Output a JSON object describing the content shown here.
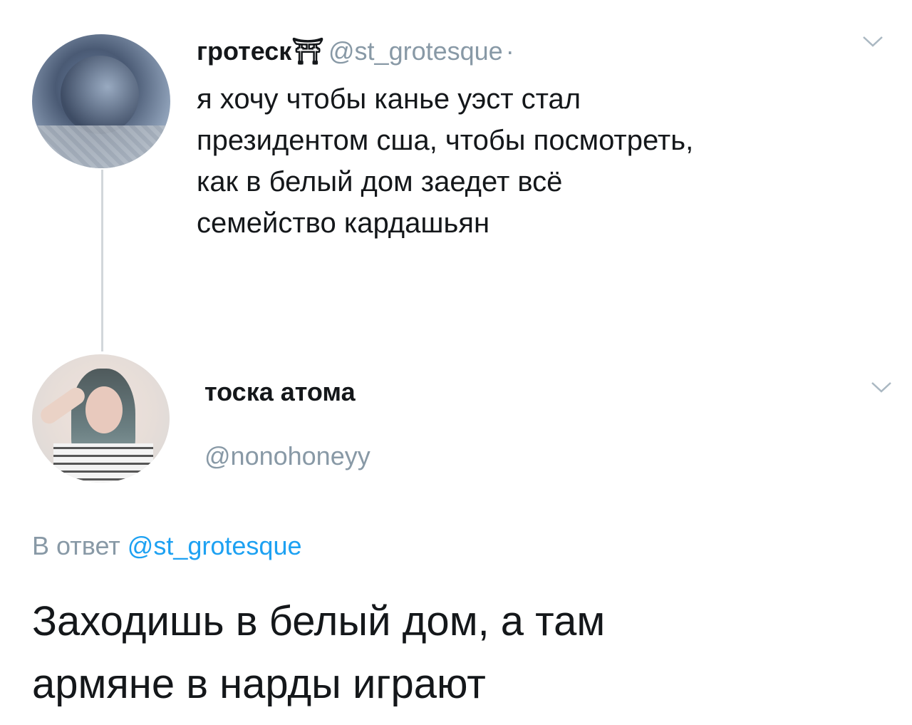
{
  "tweet": {
    "display_name": "гротеск⛩",
    "handle": "@st_grotesque",
    "separator": "·",
    "text_lines": [
      "я хочу чтобы канье уэст стал",
      "президентом сша, чтобы посмотреть,",
      "как в белый дом заедет всё",
      "семейство кардашьян"
    ],
    "avatar_icon": "user-avatar",
    "menu_icon": "chevron-down-icon"
  },
  "reply": {
    "display_name": "тоска атома",
    "handle": "@nonohoneyy",
    "reply_prefix": "В ответ",
    "reply_mention": "@st_grotesque",
    "text_lines": [
      "Заходишь в белый дом, а там",
      "армяне в нарды играют"
    ],
    "avatar_icon": "user-avatar",
    "menu_icon": "chevron-down-icon"
  },
  "colors": {
    "text": "#14171a",
    "muted": "#8899a6",
    "link": "#1da1f2",
    "thread_line": "#d2d7db"
  }
}
